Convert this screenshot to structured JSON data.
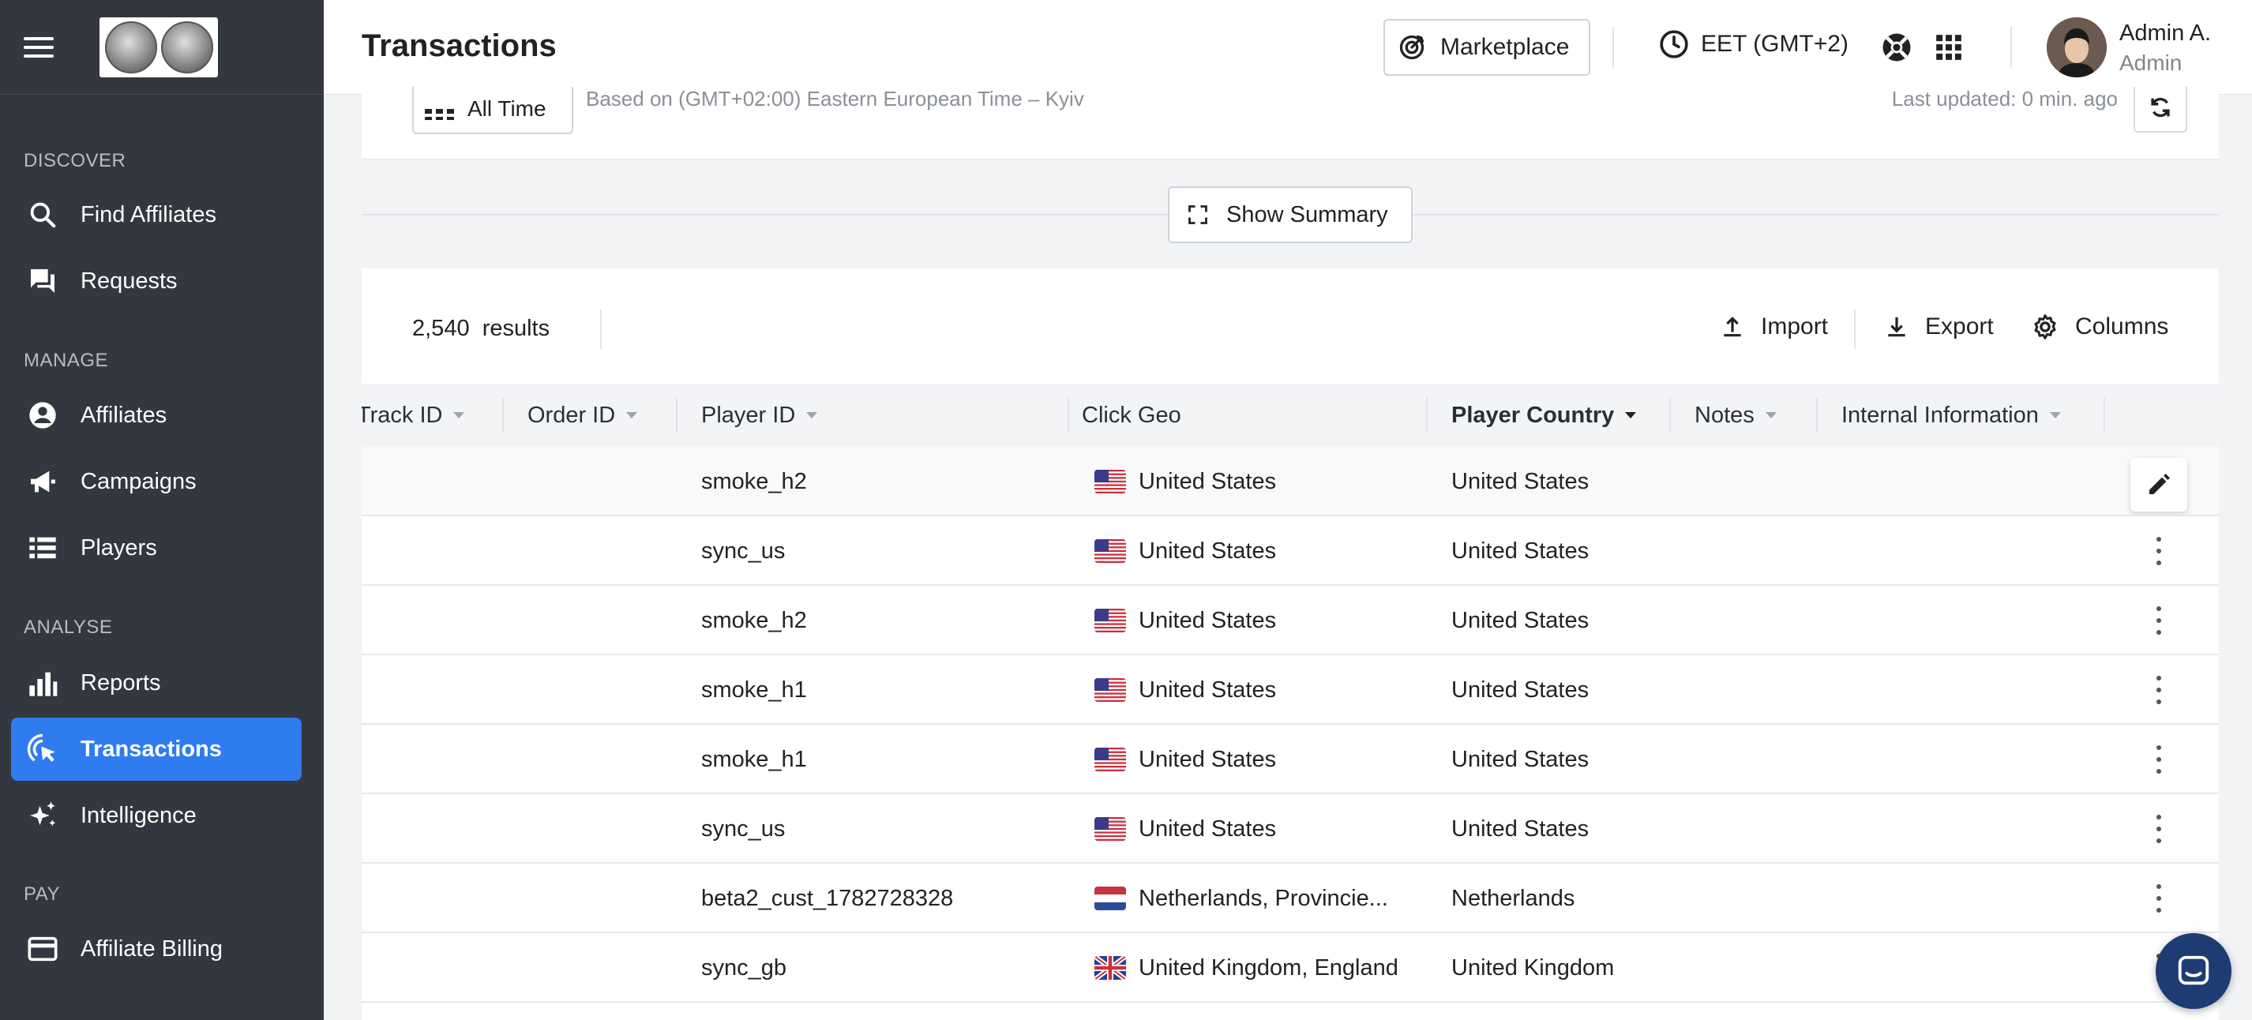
{
  "sidebar": {
    "sections": [
      {
        "label": "DISCOVER"
      },
      {
        "label": "MANAGE"
      },
      {
        "label": "ANALYSE"
      },
      {
        "label": "PAY"
      }
    ],
    "items": [
      {
        "label": "Find Affiliates",
        "icon": "search-icon"
      },
      {
        "label": "Requests",
        "icon": "chat-icon"
      },
      {
        "label": "Affiliates",
        "icon": "user-circle-icon"
      },
      {
        "label": "Campaigns",
        "icon": "megaphone-icon"
      },
      {
        "label": "Players",
        "icon": "list-icon"
      },
      {
        "label": "Reports",
        "icon": "bar-chart-icon"
      },
      {
        "label": "Transactions",
        "icon": "click-icon",
        "active": true
      },
      {
        "label": "Intelligence",
        "icon": "sparkle-icon"
      },
      {
        "label": "Affiliate Billing",
        "icon": "credit-card-icon"
      }
    ]
  },
  "header": {
    "title": "Transactions",
    "marketplace_label": "Marketplace",
    "timezone": "EET (GMT+2)",
    "user_name": "Admin A.",
    "user_role": "Admin"
  },
  "filters": {
    "period_label": "All Time",
    "timezone_note": "Based on (GMT+02:00) Eastern European Time – Kyiv",
    "last_updated": "Last updated: 0 min. ago"
  },
  "summary": {
    "show_summary_label": "Show Summary"
  },
  "table": {
    "results_count": "2,540",
    "results_label": "results",
    "import_label": "Import",
    "export_label": "Export",
    "columns_label": "Columns",
    "headers": {
      "track_id": "Track ID",
      "order_id": "Order ID",
      "player_id": "Player ID",
      "click_geo": "Click Geo",
      "player_country": "Player Country",
      "notes": "Notes",
      "internal_info": "Internal Information"
    },
    "rows": [
      {
        "player_id": "smoke_h2",
        "click_geo": "United States",
        "flag": "us",
        "player_country": "United States"
      },
      {
        "player_id": "sync_us",
        "click_geo": "United States",
        "flag": "us",
        "player_country": "United States"
      },
      {
        "player_id": "smoke_h2",
        "click_geo": "United States",
        "flag": "us",
        "player_country": "United States"
      },
      {
        "player_id": "smoke_h1",
        "click_geo": "United States",
        "flag": "us",
        "player_country": "United States"
      },
      {
        "player_id": "smoke_h1",
        "click_geo": "United States",
        "flag": "us",
        "player_country": "United States"
      },
      {
        "player_id": "sync_us",
        "click_geo": "United States",
        "flag": "us",
        "player_country": "United States"
      },
      {
        "player_id": "beta2_cust_1782728328",
        "click_geo": "Netherlands, Provincie...",
        "flag": "nl",
        "player_country": "Netherlands"
      },
      {
        "player_id": "sync_gb",
        "click_geo": "United Kingdom, England",
        "flag": "gb",
        "player_country": "United Kingdom"
      }
    ]
  },
  "colors": {
    "sidebar_bg": "#33373f",
    "accent": "#2f7bf0",
    "chat_bg": "#1f3b73"
  }
}
